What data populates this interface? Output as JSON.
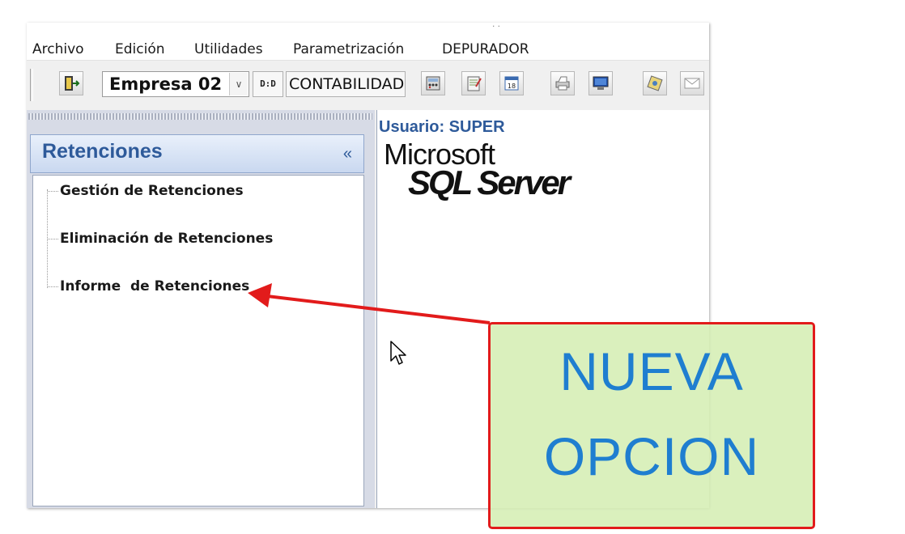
{
  "menu": [
    "Archivo",
    "Edición",
    "Utilidades",
    "Parametrización",
    "DEPURADOR"
  ],
  "toolbar": {
    "company": "Empresa 02",
    "toggle_label": "D:D",
    "module": "CONTABILIDAD",
    "icons": [
      "exit-door-icon",
      "calculator-icon",
      "notes-icon",
      "calendar-icon",
      "printer-icon",
      "monitor-icon",
      "config-icon",
      "mail-icon"
    ],
    "calendar_day": "18"
  },
  "sidebar": {
    "title": "Retenciones",
    "collapse_glyph": "«",
    "items": [
      "Gestión de Retenciones",
      "Eliminación de Retenciones",
      "Informe  de Retenciones"
    ]
  },
  "main": {
    "user_label": "Usuario: SUPER",
    "logo_line1": "Microsoft",
    "logo_line2": "SQL Server"
  },
  "callout": {
    "line1": "NUEVA",
    "line2": "OPCION"
  },
  "colors": {
    "accent": "#2e5a9a",
    "callout_text": "#1f7ed0",
    "callout_border": "#e21b1b",
    "callout_fill": "#d5eeb4"
  }
}
